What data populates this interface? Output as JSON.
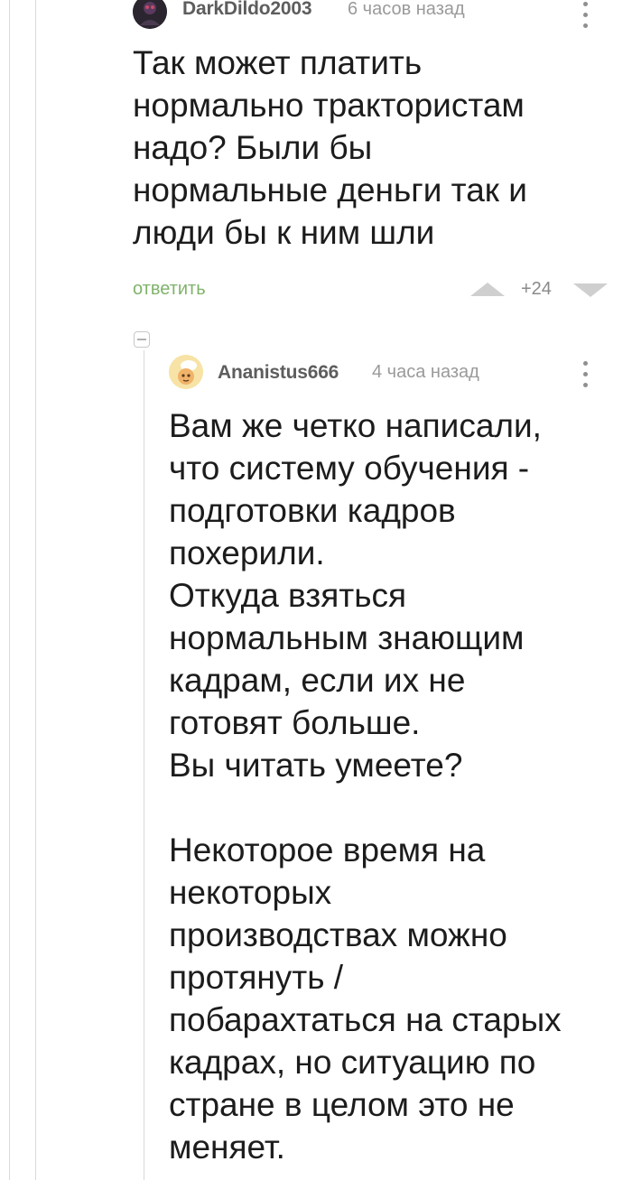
{
  "comments": [
    {
      "username": "DarkDildo2003",
      "timestamp": "6 часов назад",
      "text": "Так может платить\nнормально трактористам\nнадо? Были бы\nнормальные деньги так и\nлюди бы к ним шли",
      "reply_label": "ответить",
      "rating": "+24",
      "avatar_icon": "dark-avatar-icon",
      "more_icon": "more-vertical-icon"
    },
    {
      "username": "Ananistus666",
      "timestamp": "4 часа назад",
      "text": "Вам же четко написали,\nчто систему обучения -\nподготовки кадров\nпохерили.\nОткуда взяться\nнормальным знающим\nкадрам, если их не\nготовят больше.\nВы читать умеете?\n\nНекоторое время на\nнекоторых\nпроизводствах можно\nпротянуть /\nпобарахтаться на старых\nкадрах, но ситуацию по\nстране в целом это не\nменяет.",
      "avatar_icon": "cartoon-avatar-icon",
      "more_icon": "more-vertical-icon"
    }
  ],
  "colors": {
    "accent": "#7fb36b",
    "thread_line": "#d9d9d9",
    "text": "#1c1c1c",
    "meta": "#9a9a9a"
  }
}
